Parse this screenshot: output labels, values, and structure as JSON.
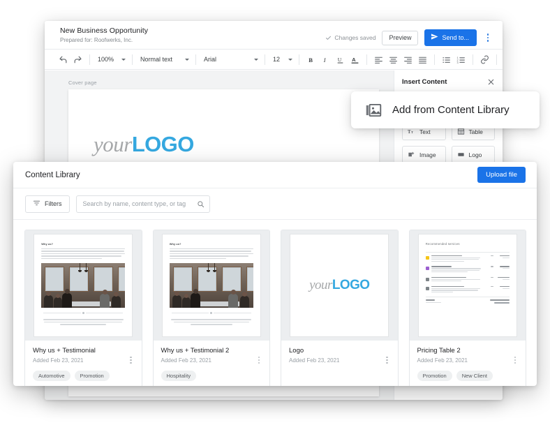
{
  "editor": {
    "doc_title": "New Business Opportunity",
    "doc_subtitle": "Prepared for: Roofwerks, Inc.",
    "saved_status": "Changes saved",
    "preview_label": "Preview",
    "send_label": "Send to...",
    "toolbar": {
      "zoom": "100%",
      "paragraph_style": "Normal text",
      "font_family": "Arial",
      "font_size": "12"
    },
    "canvas": {
      "section_label": "Cover page",
      "logo_part1": "your",
      "logo_part2": "LOGO"
    }
  },
  "insert_panel": {
    "title": "Insert Content",
    "buttons": [
      {
        "label": "Text",
        "icon": "text-icon"
      },
      {
        "label": "Table",
        "icon": "table-icon"
      },
      {
        "label": "Image",
        "icon": "image-icon"
      },
      {
        "label": "Logo",
        "icon": "logo-icon"
      }
    ]
  },
  "tooltip_card": {
    "label": "Add from Content Library",
    "icon": "image-library-icon"
  },
  "content_library": {
    "title": "Content Library",
    "upload_label": "Upload file",
    "filters_label": "Filters",
    "search_placeholder": "Search by name, content type, or tag",
    "search_value": "",
    "cards": [
      {
        "name": "Why us + Testimonial",
        "date": "Added Feb 23, 2021",
        "tags": [
          "Automotive",
          "Promotion"
        ],
        "thumb_type": "article",
        "thumb_heading": "Why us?"
      },
      {
        "name": "Why us + Testimonial 2",
        "date": "Added Feb 23, 2021",
        "tags": [
          "Hospitality"
        ],
        "thumb_type": "article",
        "thumb_heading": "Why us?"
      },
      {
        "name": "Logo",
        "date": "Added Feb 23, 2021",
        "tags": [],
        "thumb_type": "logo",
        "logo_part1": "your",
        "logo_part2": "LOGO"
      },
      {
        "name": "Pricing Table 2",
        "date": "Added Feb 23, 2021",
        "tags": [
          "Promotion",
          "New Client"
        ],
        "thumb_type": "pricing",
        "thumb_heading": "Recommended services"
      }
    ]
  },
  "colors": {
    "accent_blue": "#1a73e8",
    "logo_blue": "#35a8e0",
    "logo_gray": "#a7a9ab",
    "text_primary": "#202124",
    "text_muted": "#9aa0a6"
  }
}
